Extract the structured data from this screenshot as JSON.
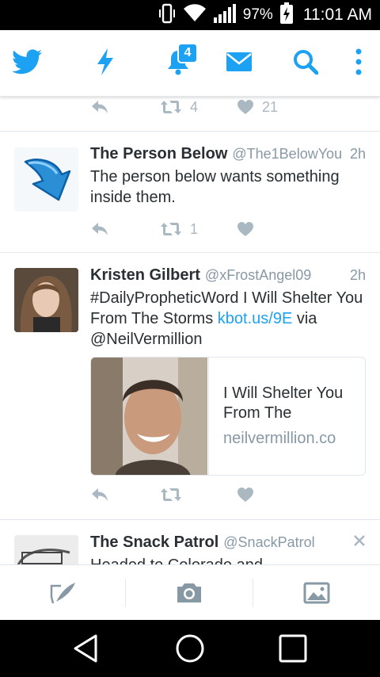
{
  "status_bar": {
    "battery_pct": "97%",
    "time": "11:01 AM"
  },
  "nav": {
    "notifications_count": "4",
    "accent": "#1da1f2"
  },
  "tweets": [
    {
      "retweets": "4",
      "likes": "21"
    },
    {
      "name": "The Person Below",
      "handle": "@The1BelowYou",
      "time": "2h",
      "text": "The person below wants something inside them.",
      "retweets": "1"
    },
    {
      "name": "Kristen Gilbert",
      "handle": "@xFrostAngel09",
      "time": "2h",
      "text_before": "#DailyPropheticWord I Will Shelter You From The Storms ",
      "link": "kbot.us/9E",
      "text_after": " via @NeilVermillion",
      "card": {
        "title": "I Will Shelter You From The",
        "domain": "neilvermillion.co"
      }
    },
    {
      "name": "The Snack Patrol",
      "handle": "@SnackPatrol",
      "text": "Headed to Colorado and"
    }
  ]
}
